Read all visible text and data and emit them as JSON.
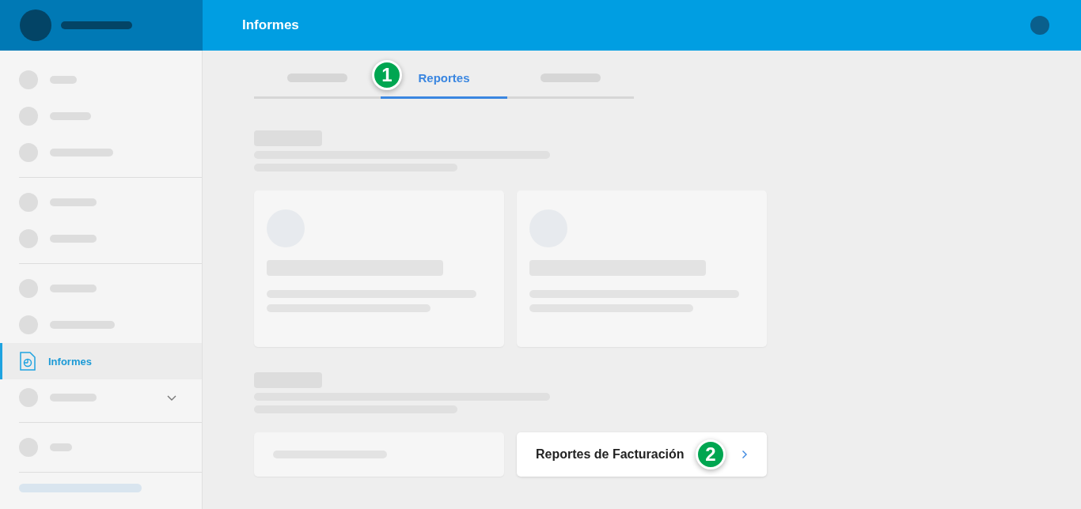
{
  "header": {
    "title": "Informes"
  },
  "sidebar": {
    "groups": [
      [
        {
          "kind": "skeleton",
          "expandable": false
        },
        {
          "kind": "skeleton",
          "expandable": false
        },
        {
          "kind": "skeleton",
          "expandable": false
        }
      ],
      [
        {
          "kind": "skeleton",
          "expandable": false
        },
        {
          "kind": "skeleton",
          "expandable": false
        }
      ],
      [
        {
          "kind": "skeleton",
          "expandable": false
        },
        {
          "kind": "skeleton",
          "expandable": false
        },
        {
          "kind": "link",
          "label": "Informes",
          "selected": true
        },
        {
          "kind": "skeleton",
          "expandable": true
        }
      ],
      [
        {
          "kind": "skeleton",
          "expandable": false
        }
      ]
    ]
  },
  "tabs": [
    {
      "kind": "skeleton",
      "selected": false
    },
    {
      "kind": "label",
      "label": "Reportes",
      "selected": true,
      "step": "1"
    },
    {
      "kind": "skeleton",
      "selected": false
    }
  ],
  "sections": [
    {
      "cards": [
        {
          "kind": "skeleton-tall"
        },
        {
          "kind": "skeleton-tall"
        }
      ]
    },
    {
      "cards": [
        {
          "kind": "skeleton-short"
        },
        {
          "kind": "link",
          "label": "Reportes de Facturación",
          "step": "2"
        }
      ]
    }
  ]
}
